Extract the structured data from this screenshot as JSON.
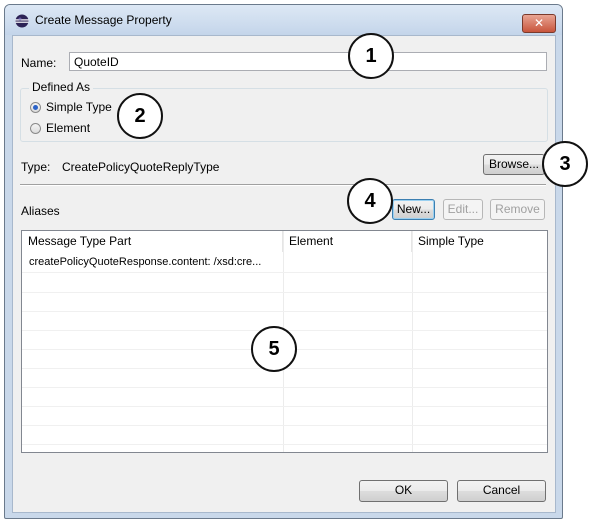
{
  "window": {
    "title": "Create Message Property",
    "close_label": "✕"
  },
  "form": {
    "name_label": "Name:",
    "name_value": "QuoteID",
    "defined_as_label": "Defined As",
    "simple_type_label": "Simple Type",
    "element_label": "Element",
    "simple_type_selected": true,
    "type_label": "Type:",
    "type_value": "CreatePolicyQuoteReplyType",
    "browse_label": "Browse..."
  },
  "aliases": {
    "label": "Aliases",
    "new_label": "New...",
    "edit_label": "Edit...",
    "remove_label": "Remove",
    "columns": [
      "Message Type  Part",
      "Element",
      "Simple Type"
    ],
    "rows": [
      [
        "createPolicyQuoteResponse.content: /xsd:cre...",
        "",
        ""
      ]
    ]
  },
  "footer": {
    "ok_label": "OK",
    "cancel_label": "Cancel"
  },
  "callouts": [
    "1",
    "2",
    "3",
    "4",
    "5"
  ],
  "colors": {
    "accent": "#2a62c8",
    "titlebar": "#c4d5ea",
    "close": "#c8553c"
  },
  "icons": [
    "eclipse-app-icon",
    "close-icon"
  ]
}
